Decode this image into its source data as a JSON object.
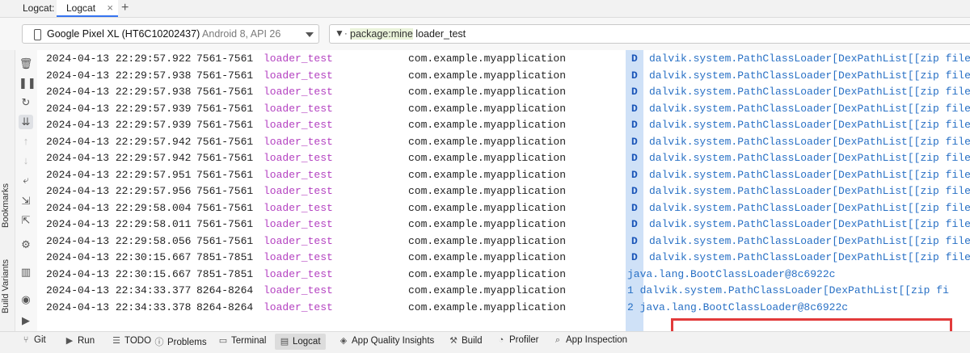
{
  "tabbar": {
    "title": "Logcat:",
    "tab_label": "Logcat",
    "close_glyph": "×",
    "add_glyph": "+"
  },
  "toolbar": {
    "device_name": "Google Pixel XL (HT6C10202437)",
    "device_api": "Android 8, API 26",
    "filter_key": "package:mine",
    "filter_value": " loader_test"
  },
  "side_panels": {
    "bookmarks": "Bookmarks",
    "build_variants": "Build Variants"
  },
  "actions": [
    {
      "icon": "trash-icon",
      "glyph": "🗑"
    },
    {
      "icon": "pause-icon",
      "glyph": "❚❚"
    },
    {
      "icon": "restart-icon",
      "glyph": "↻"
    },
    {
      "icon": "scroll-to-end-icon",
      "glyph": "⇊"
    },
    {
      "icon": "arrow-up-icon",
      "glyph": "↑"
    },
    {
      "icon": "arrow-down-icon",
      "glyph": "↓"
    },
    {
      "icon": "soft-wrap-icon",
      "glyph": "⤶"
    },
    {
      "icon": "import-icon",
      "glyph": "⇲"
    },
    {
      "icon": "export-icon",
      "glyph": "⇱"
    },
    {
      "icon": "settings-sliders-icon",
      "glyph": "⚙"
    },
    {
      "icon": "split-view-icon",
      "glyph": "▥"
    },
    {
      "icon": "camera-icon",
      "glyph": "◉"
    },
    {
      "icon": "video-icon",
      "glyph": "▶"
    }
  ],
  "log_rows": [
    {
      "date": "2024-04-13 22:29:57.922",
      "pid": "7561-7561",
      "tag": "loader_test",
      "pkg": "com.example.myapplication",
      "level": "D",
      "message": "dalvik.system.PathClassLoader[DexPathList[[zip file \""
    },
    {
      "date": "2024-04-13 22:29:57.938",
      "pid": "7561-7561",
      "tag": "loader_test",
      "pkg": "com.example.myapplication",
      "level": "D",
      "message": "dalvik.system.PathClassLoader[DexPathList[[zip file \""
    },
    {
      "date": "2024-04-13 22:29:57.938",
      "pid": "7561-7561",
      "tag": "loader_test",
      "pkg": "com.example.myapplication",
      "level": "D",
      "message": "dalvik.system.PathClassLoader[DexPathList[[zip file \""
    },
    {
      "date": "2024-04-13 22:29:57.939",
      "pid": "7561-7561",
      "tag": "loader_test",
      "pkg": "com.example.myapplication",
      "level": "D",
      "message": "dalvik.system.PathClassLoader[DexPathList[[zip file \""
    },
    {
      "date": "2024-04-13 22:29:57.939",
      "pid": "7561-7561",
      "tag": "loader_test",
      "pkg": "com.example.myapplication",
      "level": "D",
      "message": "dalvik.system.PathClassLoader[DexPathList[[zip file \""
    },
    {
      "date": "2024-04-13 22:29:57.942",
      "pid": "7561-7561",
      "tag": "loader_test",
      "pkg": "com.example.myapplication",
      "level": "D",
      "message": "dalvik.system.PathClassLoader[DexPathList[[zip file \""
    },
    {
      "date": "2024-04-13 22:29:57.942",
      "pid": "7561-7561",
      "tag": "loader_test",
      "pkg": "com.example.myapplication",
      "level": "D",
      "message": "dalvik.system.PathClassLoader[DexPathList[[zip file \""
    },
    {
      "date": "2024-04-13 22:29:57.951",
      "pid": "7561-7561",
      "tag": "loader_test",
      "pkg": "com.example.myapplication",
      "level": "D",
      "message": "dalvik.system.PathClassLoader[DexPathList[[zip file \""
    },
    {
      "date": "2024-04-13 22:29:57.956",
      "pid": "7561-7561",
      "tag": "loader_test",
      "pkg": "com.example.myapplication",
      "level": "D",
      "message": "dalvik.system.PathClassLoader[DexPathList[[zip file \""
    },
    {
      "date": "2024-04-13 22:29:58.004",
      "pid": "7561-7561",
      "tag": "loader_test",
      "pkg": "com.example.myapplication",
      "level": "D",
      "message": "dalvik.system.PathClassLoader[DexPathList[[zip file \""
    },
    {
      "date": "2024-04-13 22:29:58.011",
      "pid": "7561-7561",
      "tag": "loader_test",
      "pkg": "com.example.myapplication",
      "level": "D",
      "message": "dalvik.system.PathClassLoader[DexPathList[[zip file \""
    },
    {
      "date": "2024-04-13 22:29:58.056",
      "pid": "7561-7561",
      "tag": "loader_test",
      "pkg": "com.example.myapplication",
      "level": "D",
      "message": "dalvik.system.PathClassLoader[DexPathList[[zip file \""
    },
    {
      "date": "2024-04-13 22:30:15.667",
      "pid": "7851-7851",
      "tag": "loader_test",
      "pkg": "com.example.myapplication",
      "level": "D",
      "message": "dalvik.system.PathClassLoader[DexPathList[[zip file \""
    },
    {
      "date": "2024-04-13 22:30:15.667",
      "pid": "7851-7851",
      "tag": "loader_test",
      "pkg": "com.example.myapplication",
      "level": "",
      "message": "java.lang.BootClassLoader@8c6922c"
    },
    {
      "date": "2024-04-13 22:34:33.377",
      "pid": "8264-8264",
      "tag": "loader_test",
      "pkg": "com.example.myapplication",
      "level": "",
      "message": "1   dalvik.system.PathClassLoader[DexPathList[[zip fi"
    },
    {
      "date": "2024-04-13 22:34:33.378",
      "pid": "8264-8264",
      "tag": "loader_test",
      "pkg": "com.example.myapplication",
      "level": "",
      "message": "2   java.lang.BootClassLoader@8c6922c"
    }
  ],
  "bottom_tools": [
    {
      "label": "Git",
      "icon": "git-branch-icon",
      "glyph": "⑂"
    },
    {
      "label": "Run",
      "icon": "run-icon",
      "glyph": "▶"
    },
    {
      "label": "TODO",
      "icon": "todo-list-icon",
      "glyph": "☰"
    },
    {
      "label": "Problems",
      "icon": "problems-icon",
      "glyph": "ⓘ"
    },
    {
      "label": "Terminal",
      "icon": "terminal-icon",
      "glyph": "▭"
    },
    {
      "label": "Logcat",
      "icon": "logcat-icon",
      "glyph": "▤",
      "active": true
    },
    {
      "label": "App Quality Insights",
      "icon": "quality-insights-icon",
      "glyph": "◈"
    },
    {
      "label": "Build",
      "icon": "hammer-icon",
      "glyph": "⚒"
    },
    {
      "label": "Profiler",
      "icon": "profiler-gauge-icon",
      "glyph": "◔"
    },
    {
      "label": "App Inspection",
      "icon": "app-inspection-icon",
      "glyph": "⌕"
    }
  ],
  "colors": {
    "tag": "#b442c1",
    "message": "#2870c5",
    "level_column": "#cfe1f7",
    "highlight_box": "#e23b3b",
    "filter_key_bg": "#eaf3da"
  }
}
